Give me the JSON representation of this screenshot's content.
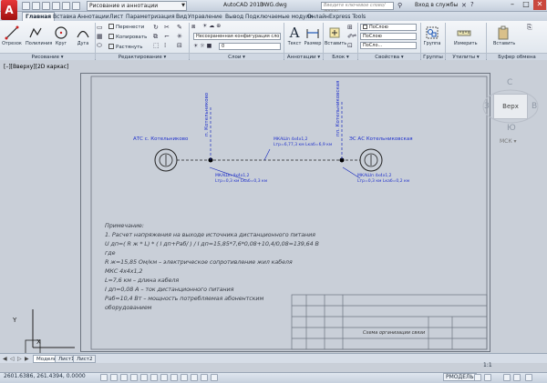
{
  "titlebar": {
    "app_button": "A",
    "workspace": "Рисование и аннотации",
    "app_name": "AutoCAD 2013",
    "file_name": "DWG.dwg",
    "search_placeholder": "Введите ключевое слово/фразу",
    "login": "Вход в службы"
  },
  "tabs": [
    "Главная",
    "Вставка",
    "Аннотации",
    "Лист",
    "Параметризация",
    "Вид",
    "Управление",
    "Вывод",
    "Подключаемые модули",
    "Онлайн",
    "Express Tools"
  ],
  "ribbon": {
    "draw_tools": [
      {
        "label": "Отрезок",
        "icon": "line-icon"
      },
      {
        "label": "Полилиния",
        "icon": "polyline-icon"
      },
      {
        "label": "Круг",
        "icon": "circle-icon"
      },
      {
        "label": "Дуга",
        "icon": "arc-icon"
      }
    ],
    "modify_tools": [
      "Перенести",
      "Копировать",
      "Растянуть"
    ],
    "layer_combo": "Несохраненная конфигурация сло",
    "layer_name": "0",
    "annotation_tool": "Текст",
    "annotation_size": "Размер",
    "block_tool": "Вставить",
    "properties": [
      "ПоСлою",
      "ПоСлою",
      "ПоСло..."
    ],
    "group_tool": "Группа",
    "utility_tool": "Измерить",
    "clipboard_tool": "Вставить",
    "panels": [
      "Рисование",
      "Редактирование",
      "Слои",
      "Аннотации",
      "Блок",
      "Свойства",
      "Группы",
      "Утилиты",
      "Буфер обмена"
    ]
  },
  "viewport_label": "[–][Вверху][2D каркас]",
  "drawing": {
    "left_label": "АТС с. Котельниково",
    "right_label": "ЭС АС Котельниковская",
    "left_vertical": "п. Котельниково",
    "right_vertical": "пл. Котельниковская",
    "cable_top_line1": "МКАШп 4х4х1,2",
    "cable_top_line2": "Lтр=6,77,3 км Lкаб=6,9 км",
    "cable_left_line1": "МКАШп 4х4х1,2",
    "cable_left_line2": "Lтр=0,3 км Lкаб=0,3 км",
    "cable_right_line1": "МКАШп 4х4х1,2",
    "cable_right_line2": "Lтр=0,3 км Lкаб=0,2 км",
    "notes": [
      "Примечание:",
      "1. Расчет напряжения на выходе источника дистанционного питания",
      "U дп=( R ж * L) * ( I дп+Pаб/ ) / I дп=15,85*7,6*0,08+10,4/0,08=139,64 В",
      "где",
      "R ж=15,85 Ом/км – электрическое сопротивление жил кабеля",
      "МКС 4х4х1,2",
      "L=7,6 км – длина кабеля",
      "I дп=0,08 А – ток дистанционного питания",
      "Pаб=10,4 Вт – мощность потребляемая абонентским",
      "оборудованием"
    ],
    "title_block_text": "Схема организации связи"
  },
  "viewcube": {
    "top_face": "Верх",
    "north": "С",
    "south": "Ю",
    "west": "З",
    "east": "В",
    "wcs": "МСК ▾"
  },
  "ucs": {
    "x": "X",
    "y": "Y"
  },
  "layout_tabs": [
    "Модель",
    "Лист1",
    "Лист2"
  ],
  "status": {
    "coordinates": "2601.6386, 261.4394, 0.0000",
    "model": "РМОДЕЛЬ",
    "scale": "1:1"
  }
}
